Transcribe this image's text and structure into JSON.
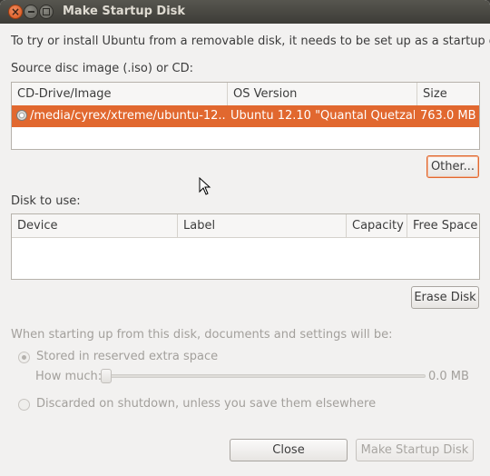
{
  "window": {
    "title": "Make Startup Disk"
  },
  "intro": "To try or install Ubuntu from a removable disk, it needs to be set up as a startup disk.",
  "source": {
    "label": "Source disc image (.iso) or CD:",
    "columns": [
      "CD-Drive/Image",
      "OS Version",
      "Size"
    ],
    "rows": [
      {
        "image": "/media/cyrex/xtreme/ubuntu-12...",
        "os_version": "Ubuntu 12.10 \"Quantal Quetzal...",
        "size": "763.0 MB"
      }
    ],
    "other_button": "Other..."
  },
  "disk": {
    "label": "Disk to use:",
    "columns": [
      "Device",
      "Label",
      "Capacity",
      "Free Space"
    ],
    "rows": [],
    "erase_button": "Erase Disk"
  },
  "options": {
    "heading": "When starting up from this disk, documents and settings will be:",
    "stored_label": "Stored in reserved extra space",
    "how_much_label": "How much:",
    "how_much_value": "0.0 MB",
    "slider_fraction": 0,
    "discard_label": "Discarded on shutdown, unless you save them elsewhere",
    "selected": "stored"
  },
  "buttons": {
    "close": "Close",
    "make": "Make Startup Disk"
  },
  "colors": {
    "selection": "#e1682f",
    "titlebar": "#3d3c37"
  }
}
